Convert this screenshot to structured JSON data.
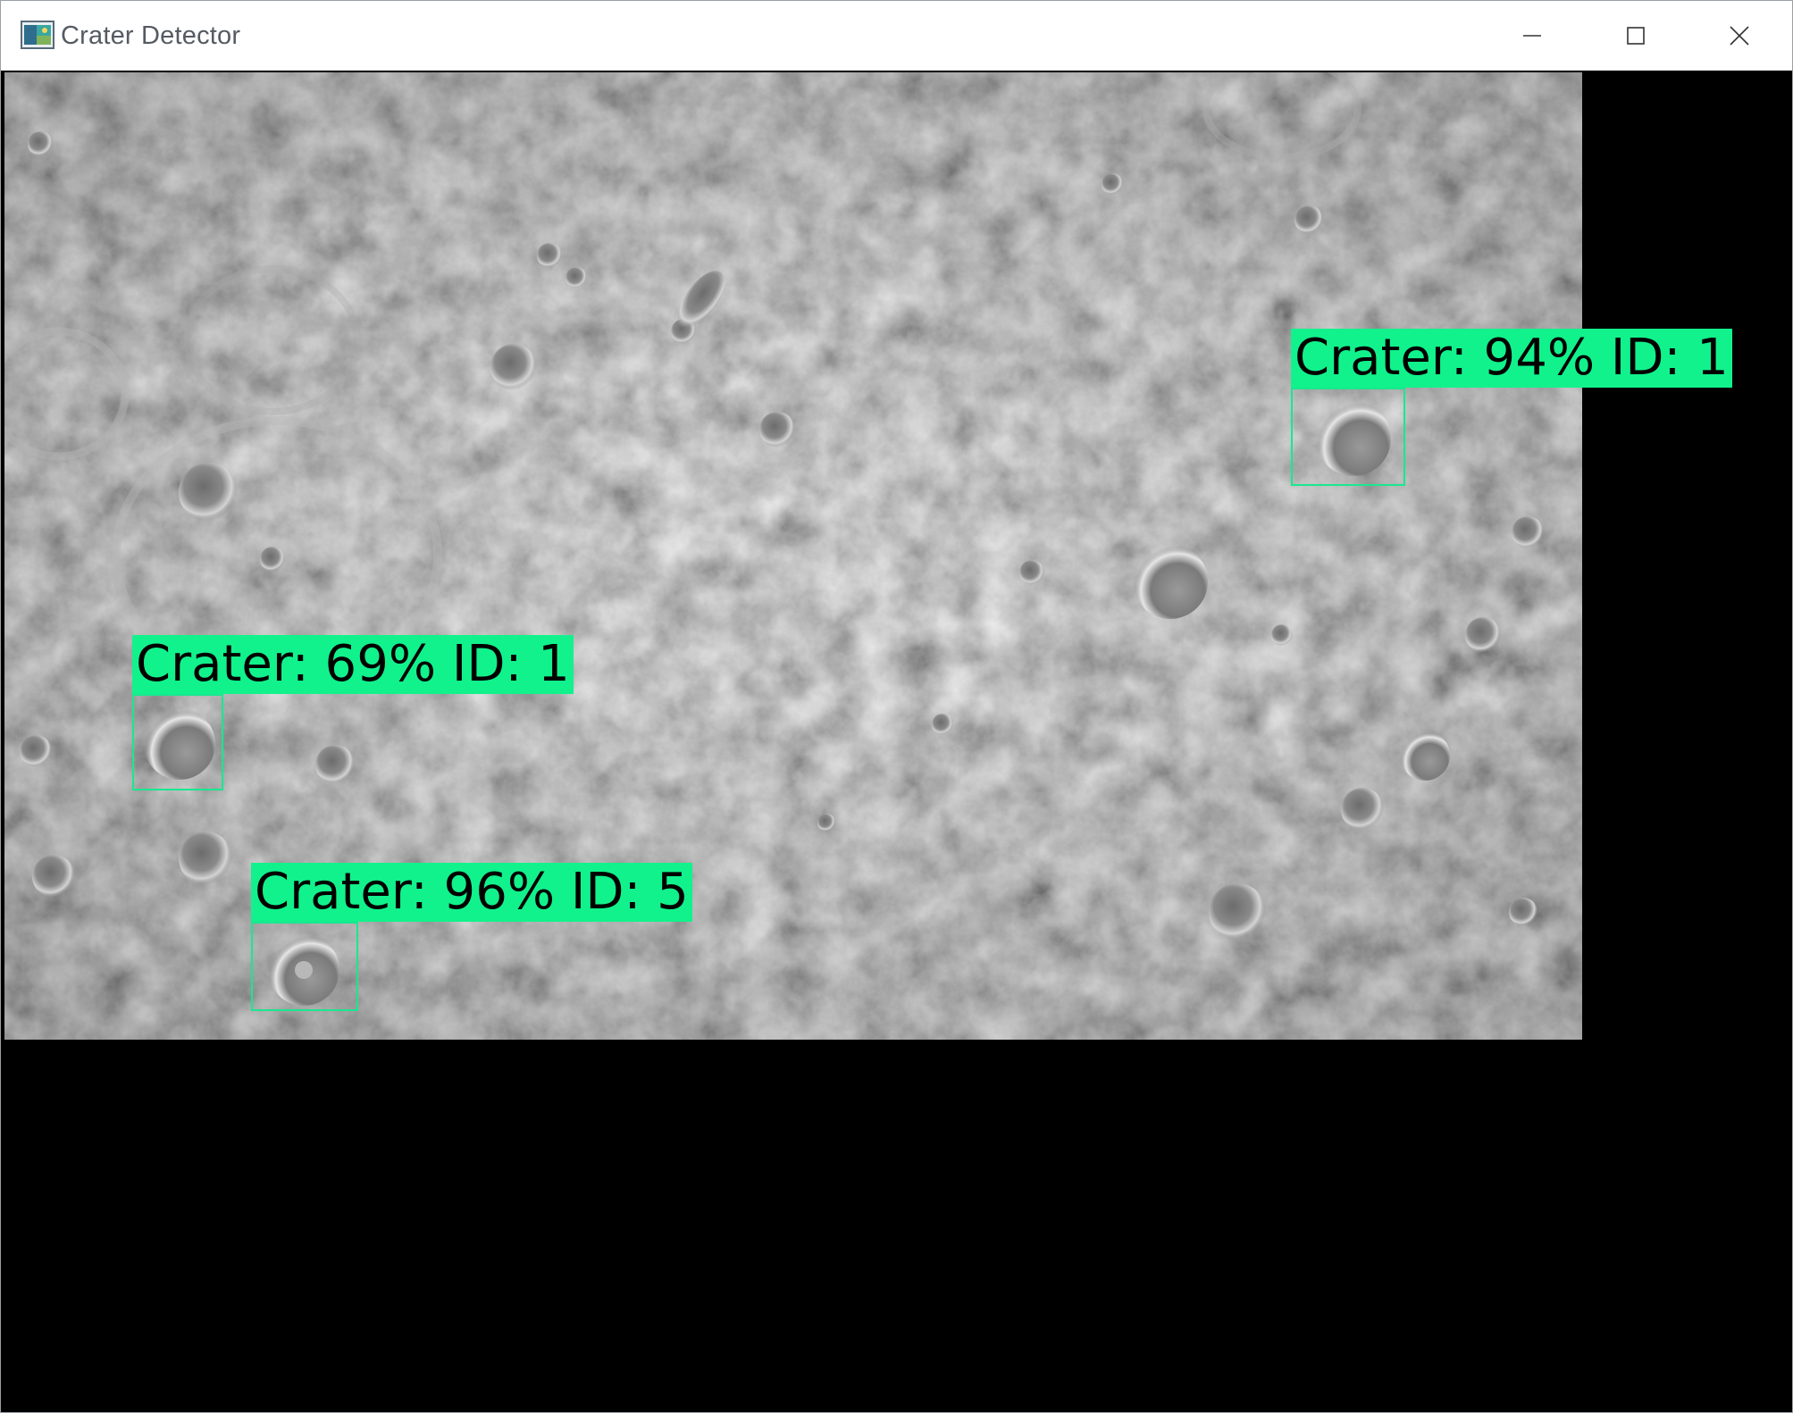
{
  "window": {
    "title": "Crater Detector",
    "icon": "app-image-icon",
    "controls": {
      "minimize_icon": "minimize-icon",
      "maximize_icon": "maximize-icon",
      "close_icon": "close-icon"
    }
  },
  "detections": [
    {
      "label": "Crater: 94% ID: 1",
      "class": "Crater",
      "confidence_pct": 94,
      "id": 1
    },
    {
      "label": "Crater: 69% ID: 1",
      "class": "Crater",
      "confidence_pct": 69,
      "id": 1
    },
    {
      "label": "Crater: 96% ID: 5",
      "class": "Crater",
      "confidence_pct": 96,
      "id": 5
    }
  ],
  "colors": {
    "detection_box": "#17e88f",
    "label_background": "#11f28c",
    "letterbox": "#000000",
    "titlebar": "#ffffff"
  }
}
